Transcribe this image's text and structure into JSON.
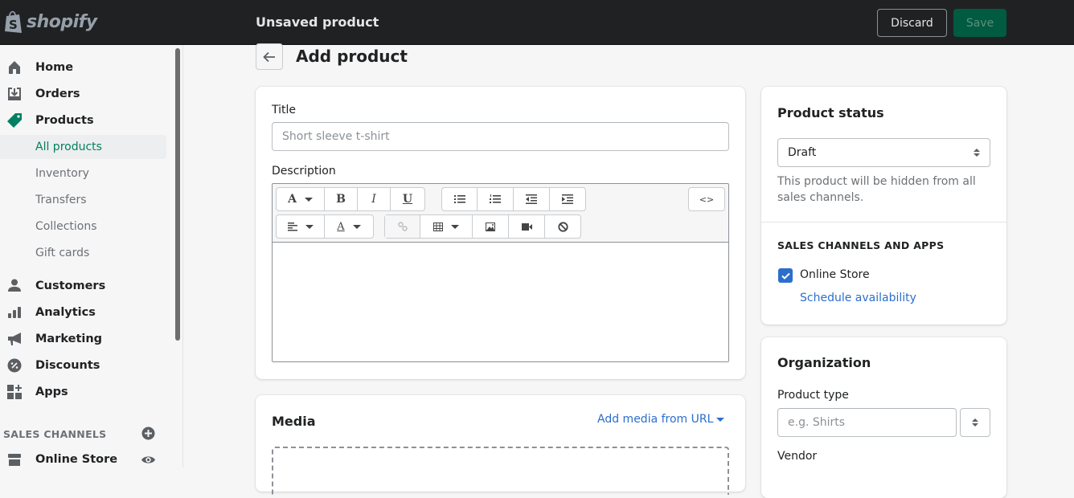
{
  "topbar": {
    "logo_text": "shopify",
    "title": "Unsaved product",
    "discard_label": "Discard",
    "save_label": "Save"
  },
  "sidebar": {
    "items": [
      {
        "label": "Home",
        "icon": "home-icon"
      },
      {
        "label": "Orders",
        "icon": "orders-icon"
      },
      {
        "label": "Products",
        "icon": "tag-icon",
        "active": true
      }
    ],
    "sub_items": [
      {
        "label": "All products",
        "active": true
      },
      {
        "label": "Inventory"
      },
      {
        "label": "Transfers"
      },
      {
        "label": "Collections"
      },
      {
        "label": "Gift cards"
      }
    ],
    "items2": [
      {
        "label": "Customers",
        "icon": "customer-icon"
      },
      {
        "label": "Analytics",
        "icon": "analytics-icon"
      },
      {
        "label": "Marketing",
        "icon": "megaphone-icon"
      },
      {
        "label": "Discounts",
        "icon": "discount-icon"
      },
      {
        "label": "Apps",
        "icon": "apps-icon"
      }
    ],
    "sales_channels_heading": "SALES CHANNELS",
    "channels": [
      {
        "label": "Online Store",
        "icon": "store-icon"
      }
    ]
  },
  "page": {
    "title": "Add product",
    "title_label": "Title",
    "title_placeholder": "Short sleeve t-shirt",
    "description_label": "Description",
    "toolbar": {
      "format": "A",
      "bold": "B",
      "italic": "I",
      "underline": "U",
      "html": "<>",
      "text_color": "A"
    },
    "media": {
      "title": "Media",
      "add_from_url": "Add media from URL"
    }
  },
  "status_card": {
    "title": "Product status",
    "status_value": "Draft",
    "status_help": "This product will be hidden from all sales channels.",
    "channels_heading": "SALES CHANNELS AND APPS",
    "channel_label": "Online Store",
    "channel_checked": true,
    "schedule_link": "Schedule availability"
  },
  "organization": {
    "title": "Organization",
    "product_type_label": "Product type",
    "product_type_placeholder": "e.g. Shirts",
    "vendor_label": "Vendor"
  },
  "colors": {
    "brand_green": "#008060",
    "save_bg": "#005b41",
    "link_blue": "#2c6ecb",
    "topbar_bg": "#202123"
  }
}
